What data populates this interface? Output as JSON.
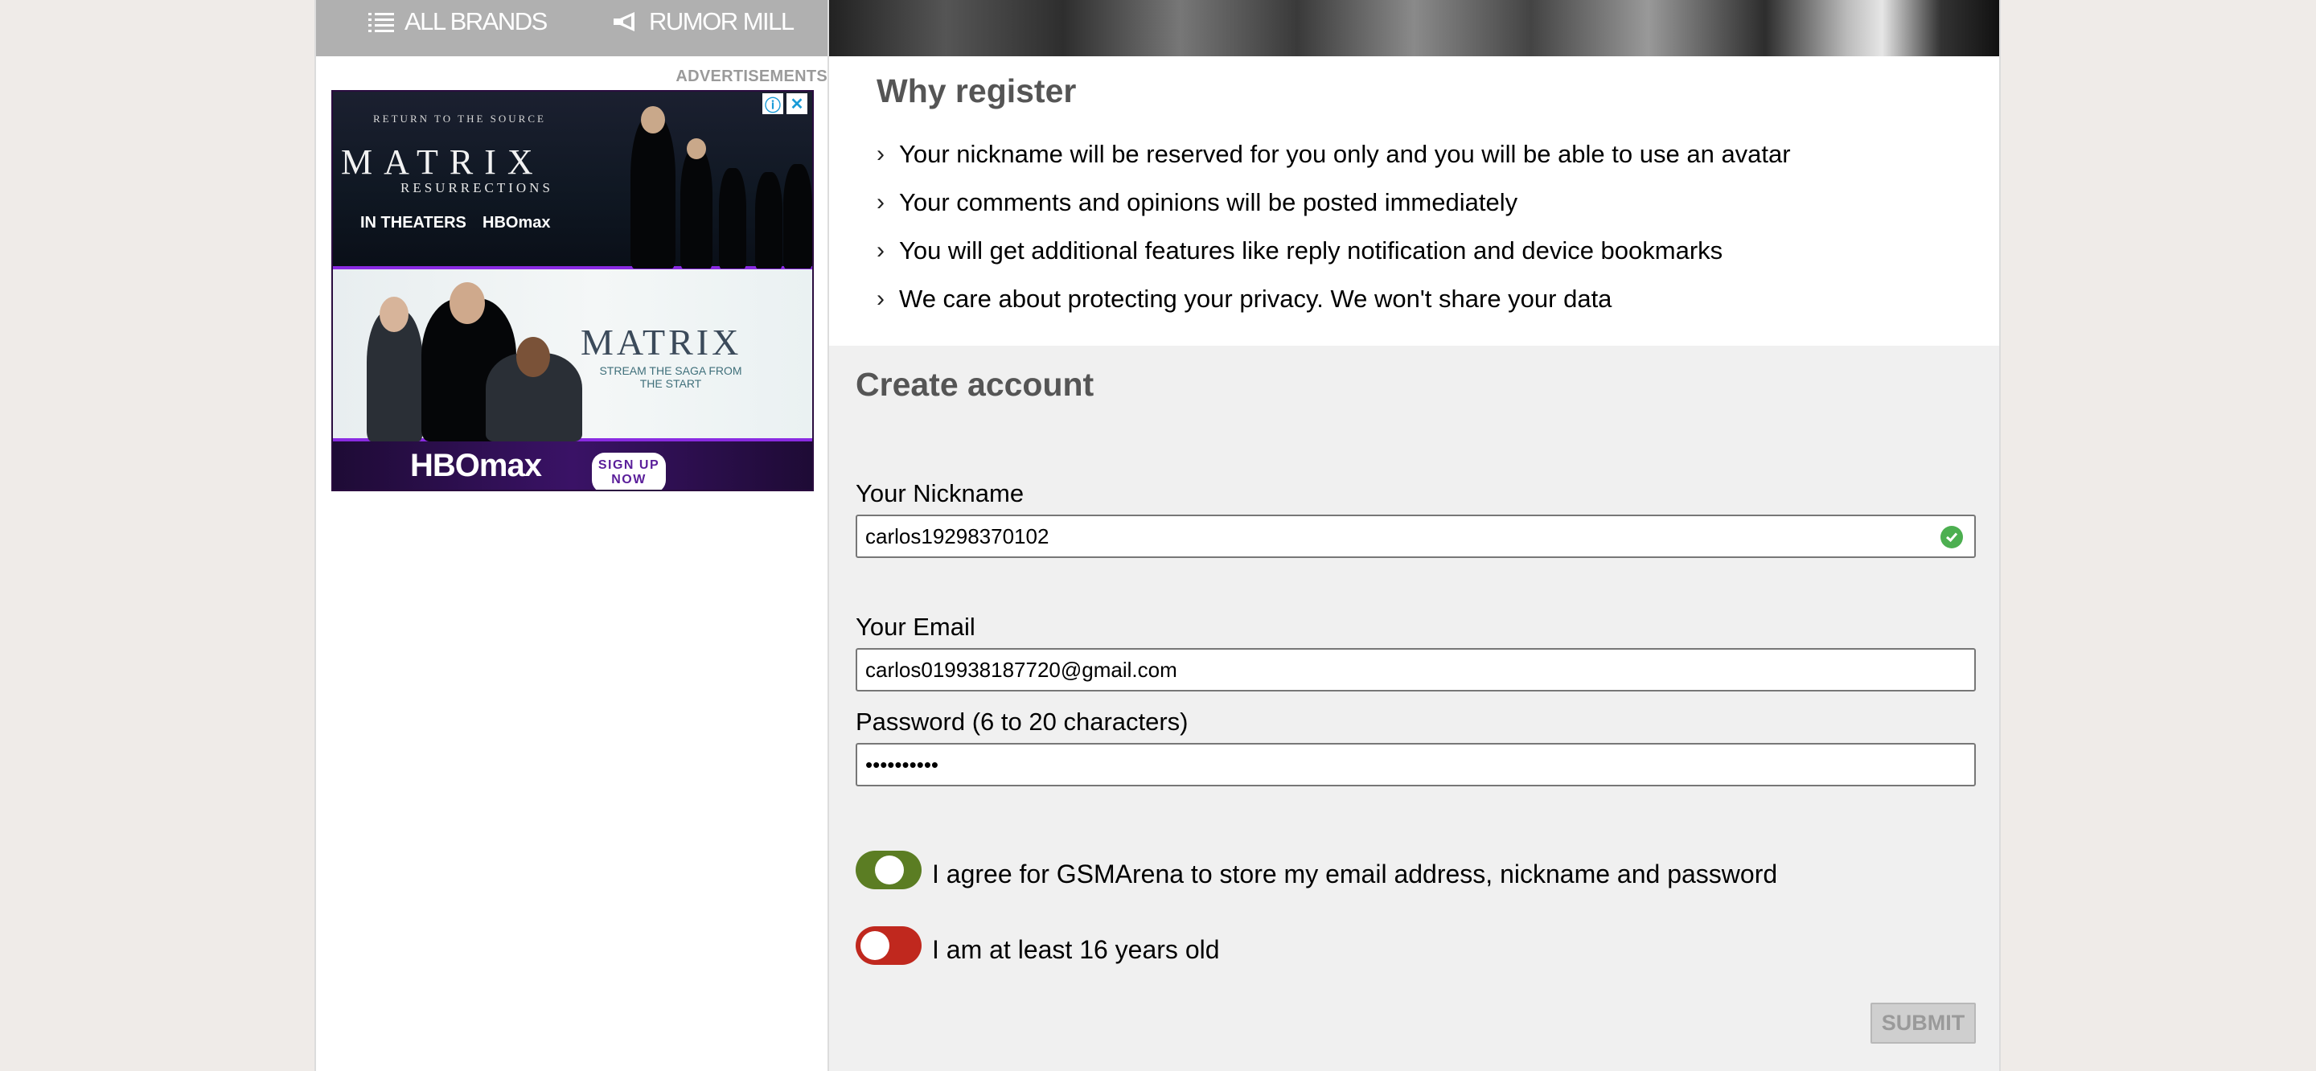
{
  "nav": {
    "all_brands": "ALL BRANDS",
    "rumor_mill": "RUMOR MILL"
  },
  "ad": {
    "label": "ADVERTISEMENTS",
    "tagline": "RETURN TO THE SOURCE",
    "title": "MATRIX",
    "subtitle": "RESURRECTIONS",
    "in_theaters": "IN THEATERS",
    "hbo_small": "HBOmax",
    "title2": "MATRIX",
    "stream": "STREAM THE SAGA FROM THE START",
    "hbo_logo": "HBOmax",
    "signup": "SIGN UP NOW"
  },
  "why": {
    "title": "Why register",
    "items": [
      "Your nickname will be reserved for you only and you will be able to use an avatar",
      "Your comments and opinions will be posted immediately",
      "You will get additional features like reply notification and device bookmarks",
      "We care about protecting your privacy. We won't share your data"
    ]
  },
  "form": {
    "title": "Create account",
    "nickname_label": "Your Nickname",
    "nickname_value": "carlos19298370102",
    "email_label": "Your Email",
    "email_value": "carlos019938187720@gmail.com",
    "password_label": "Password (6 to 20 characters)",
    "password_value": "••••••••••",
    "agree_label": "I agree for GSMArena to store my email address, nickname and password",
    "agree_on": true,
    "age_label": "I am at least 16 years old",
    "age_on": false,
    "submit": "SUBMIT"
  },
  "colors": {
    "toggle_on": "#5b7d23",
    "toggle_off": "#c0281e",
    "valid_check": "#4caf50"
  }
}
